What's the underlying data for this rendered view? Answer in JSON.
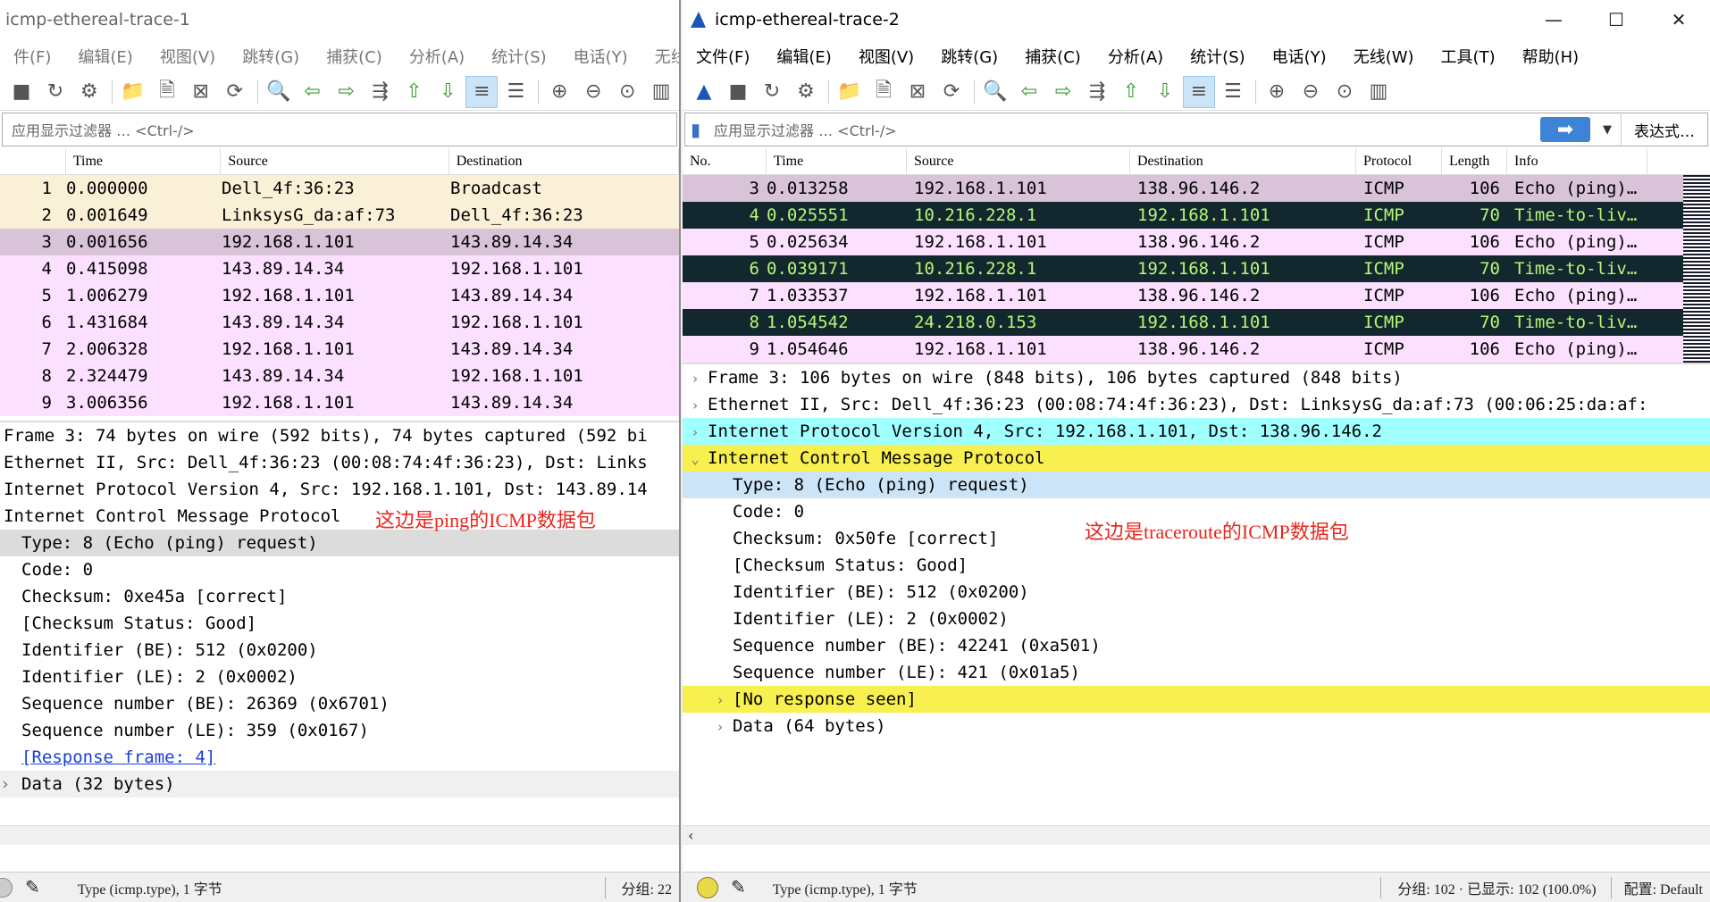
{
  "left": {
    "title": "icmp-ethereal-trace-1",
    "menu": [
      "件(F)",
      "编辑(E)",
      "视图(V)",
      "跳转(G)",
      "捕获(C)",
      "分析(A)",
      "统计(S)",
      "电话(Y)",
      "无线"
    ],
    "filter_placeholder": "应用显示过滤器 … <Ctrl-/>",
    "columns": {
      "time": "Time",
      "source": "Source",
      "destination": "Destination"
    },
    "packets": [
      {
        "no": "1",
        "time": "0.000000",
        "src": "Dell_4f:36:23",
        "dst": "Broadcast",
        "bg": "#faf0d7",
        "fg": "#000"
      },
      {
        "no": "2",
        "time": "0.001649",
        "src": "LinksysG_da:af:73",
        "dst": "Dell_4f:36:23",
        "bg": "#faf0d7",
        "fg": "#000"
      },
      {
        "no": "3",
        "time": "0.001656",
        "src": "192.168.1.101",
        "dst": "143.89.14.34",
        "bg": "#d8c3d9",
        "fg": "#000"
      },
      {
        "no": "4",
        "time": "0.415098",
        "src": "143.89.14.34",
        "dst": "192.168.1.101",
        "bg": "#fce0ff",
        "fg": "#000"
      },
      {
        "no": "5",
        "time": "1.006279",
        "src": "192.168.1.101",
        "dst": "143.89.14.34",
        "bg": "#fce0ff",
        "fg": "#000"
      },
      {
        "no": "6",
        "time": "1.431684",
        "src": "143.89.14.34",
        "dst": "192.168.1.101",
        "bg": "#fce0ff",
        "fg": "#000"
      },
      {
        "no": "7",
        "time": "2.006328",
        "src": "192.168.1.101",
        "dst": "143.89.14.34",
        "bg": "#fce0ff",
        "fg": "#000"
      },
      {
        "no": "8",
        "time": "2.324479",
        "src": "143.89.14.34",
        "dst": "192.168.1.101",
        "bg": "#fce0ff",
        "fg": "#000"
      },
      {
        "no": "9",
        "time": "3.006356",
        "src": "192.168.1.101",
        "dst": "143.89.14.34",
        "bg": "#fce0ff",
        "fg": "#000"
      }
    ],
    "details": [
      {
        "text": "Frame 3: 74 bytes on wire (592 bits), 74 bytes captured (592 bi",
        "indent": 0,
        "bg": "#fff",
        "link": false
      },
      {
        "text": "Ethernet II, Src: Dell_4f:36:23 (00:08:74:4f:36:23), Dst: Links",
        "indent": 0,
        "bg": "#fff",
        "link": false
      },
      {
        "text": "Internet Protocol Version 4, Src: 192.168.1.101, Dst: 143.89.14",
        "indent": 0,
        "bg": "#fff",
        "link": false
      },
      {
        "text": "Internet Control Message Protocol",
        "indent": 0,
        "bg": "#fff",
        "link": false
      },
      {
        "text": "Type: 8 (Echo (ping) request)",
        "indent": 1,
        "bg": "#dcdcdc",
        "link": false
      },
      {
        "text": "Code: 0",
        "indent": 1,
        "bg": "#fff",
        "link": false
      },
      {
        "text": "Checksum: 0xe45a [correct]",
        "indent": 1,
        "bg": "#fff",
        "link": false
      },
      {
        "text": "[Checksum Status: Good]",
        "indent": 1,
        "bg": "#fff",
        "link": false
      },
      {
        "text": "Identifier (BE): 512 (0x0200)",
        "indent": 1,
        "bg": "#fff",
        "link": false
      },
      {
        "text": "Identifier (LE): 2 (0x0002)",
        "indent": 1,
        "bg": "#fff",
        "link": false
      },
      {
        "text": "Sequence number (BE): 26369 (0x6701)",
        "indent": 1,
        "bg": "#fff",
        "link": false
      },
      {
        "text": "Sequence number (LE): 359 (0x0167)",
        "indent": 1,
        "bg": "#fff",
        "link": false
      },
      {
        "text": "[Response frame: 4]",
        "indent": 1,
        "bg": "#fff",
        "link": true
      },
      {
        "text": "Data (32 bytes)",
        "indent": 1,
        "bg": "#f0f0f0",
        "link": false,
        "chev": "›"
      }
    ],
    "note": "这边是ping的ICMP数据包",
    "status_field": "Type (icmp.type), 1 字节",
    "status_packets": "分组: 22"
  },
  "right": {
    "title": "icmp-ethereal-trace-2",
    "menu": [
      "文件(F)",
      "编辑(E)",
      "视图(V)",
      "跳转(G)",
      "捕获(C)",
      "分析(A)",
      "统计(S)",
      "电话(Y)",
      "无线(W)",
      "工具(T)",
      "帮助(H)"
    ],
    "filter_placeholder": "应用显示过滤器 … <Ctrl-/>",
    "expression_label": "表达式…",
    "columns": {
      "no": "No.",
      "time": "Time",
      "source": "Source",
      "destination": "Destination",
      "protocol": "Protocol",
      "length": "Length",
      "info": "Info"
    },
    "packets": [
      {
        "no": "3",
        "time": "0.013258",
        "src": "192.168.1.101",
        "dst": "138.96.146.2",
        "proto": "ICMP",
        "len": "106",
        "info": "Echo (ping)…",
        "bg": "#d8c3d9",
        "fg": "#000"
      },
      {
        "no": "4",
        "time": "0.025551",
        "src": "10.216.228.1",
        "dst": "192.168.1.101",
        "proto": "ICMP",
        "len": "70",
        "info": "Time-to-liv…",
        "bg": "#12272e",
        "fg": "#b7f774"
      },
      {
        "no": "5",
        "time": "0.025634",
        "src": "192.168.1.101",
        "dst": "138.96.146.2",
        "proto": "ICMP",
        "len": "106",
        "info": "Echo (ping)…",
        "bg": "#fce0ff",
        "fg": "#000"
      },
      {
        "no": "6",
        "time": "0.039171",
        "src": "10.216.228.1",
        "dst": "192.168.1.101",
        "proto": "ICMP",
        "len": "70",
        "info": "Time-to-liv…",
        "bg": "#12272e",
        "fg": "#b7f774"
      },
      {
        "no": "7",
        "time": "1.033537",
        "src": "192.168.1.101",
        "dst": "138.96.146.2",
        "proto": "ICMP",
        "len": "106",
        "info": "Echo (ping)…",
        "bg": "#fce0ff",
        "fg": "#000"
      },
      {
        "no": "8",
        "time": "1.054542",
        "src": "24.218.0.153",
        "dst": "192.168.1.101",
        "proto": "ICMP",
        "len": "70",
        "info": "Time-to-liv…",
        "bg": "#12272e",
        "fg": "#b7f774"
      },
      {
        "no": "9",
        "time": "1.054646",
        "src": "192.168.1.101",
        "dst": "138.96.146.2",
        "proto": "ICMP",
        "len": "106",
        "info": "Echo (ping)…",
        "bg": "#fce0ff",
        "fg": "#000"
      }
    ],
    "details": [
      {
        "text": "Frame 3: 106 bytes on wire (848 bits), 106 bytes captured (848 bits)",
        "indent": 0,
        "bg": "#fff",
        "chev": "›"
      },
      {
        "text": "Ethernet II, Src: Dell_4f:36:23 (00:08:74:4f:36:23), Dst: LinksysG_da:af:73 (00:06:25:da:af:",
        "indent": 0,
        "bg": "#fff",
        "chev": "›"
      },
      {
        "text": "Internet Protocol Version 4, Src: 192.168.1.101, Dst: 138.96.146.2",
        "indent": 0,
        "bg": "#a0ffff",
        "chev": "›"
      },
      {
        "text": "Internet Control Message Protocol",
        "indent": 0,
        "bg": "#f7f04e",
        "chev": "⌄"
      },
      {
        "text": "Type: 8 (Echo (ping) request)",
        "indent": 1,
        "bg": "#cce4f7",
        "chev": ""
      },
      {
        "text": "Code: 0",
        "indent": 1,
        "bg": "#fff",
        "chev": ""
      },
      {
        "text": "Checksum: 0x50fe [correct]",
        "indent": 1,
        "bg": "#fff",
        "chev": ""
      },
      {
        "text": "[Checksum Status: Good]",
        "indent": 1,
        "bg": "#fff",
        "chev": ""
      },
      {
        "text": "Identifier (BE): 512 (0x0200)",
        "indent": 1,
        "bg": "#fff",
        "chev": ""
      },
      {
        "text": "Identifier (LE): 2 (0x0002)",
        "indent": 1,
        "bg": "#fff",
        "chev": ""
      },
      {
        "text": "Sequence number (BE): 42241 (0xa501)",
        "indent": 1,
        "bg": "#fff",
        "chev": ""
      },
      {
        "text": "Sequence number (LE): 421 (0x01a5)",
        "indent": 1,
        "bg": "#fff",
        "chev": ""
      },
      {
        "text": "[No response seen]",
        "indent": 1,
        "bg": "#f7f04e",
        "chev": "›"
      },
      {
        "text": "Data (64 bytes)",
        "indent": 1,
        "bg": "#fff",
        "chev": "›"
      }
    ],
    "note": "这边是traceroute的ICMP数据包",
    "status_field": "Type (icmp.type), 1 字节",
    "status_packets": "分组: 102 · 已显示: 102 (100.0%)",
    "status_profile": "配置: Default"
  }
}
